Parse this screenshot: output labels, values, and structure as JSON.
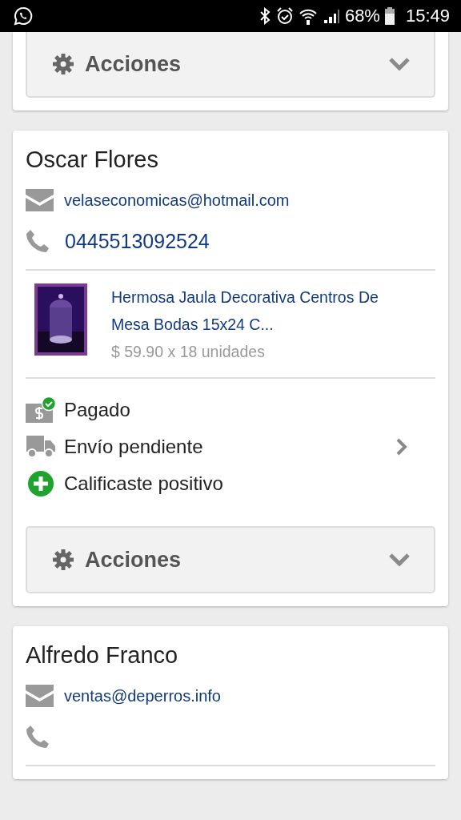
{
  "status_bar": {
    "battery_text": "68%",
    "time": "15:49"
  },
  "orders": [
    {
      "cut_top": true,
      "actions": {
        "label": "Acciones"
      }
    },
    {
      "cut_top": false,
      "buyer": "Oscar Flores",
      "email": "velaseconomicas@hotmail.com",
      "phone": "0445513092524",
      "product": {
        "kind": "picture",
        "title": "Hermosa Jaula Decorativa Centros De Mesa Bodas 15x24 C...",
        "price": "$ 59.90 x 18 unidades"
      },
      "statuses": [
        {
          "kind": "paid",
          "label": "Pagado",
          "chevron": false
        },
        {
          "kind": "shipping",
          "label": "Envío pendiente",
          "chevron": true
        },
        {
          "kind": "rating",
          "label": "Calificaste positivo",
          "chevron": false
        }
      ],
      "actions": {
        "label": "Acciones"
      }
    },
    {
      "cut_top": false,
      "buyer": "Alfredo Franco",
      "email": "ventas@deperros.info"
    }
  ]
}
